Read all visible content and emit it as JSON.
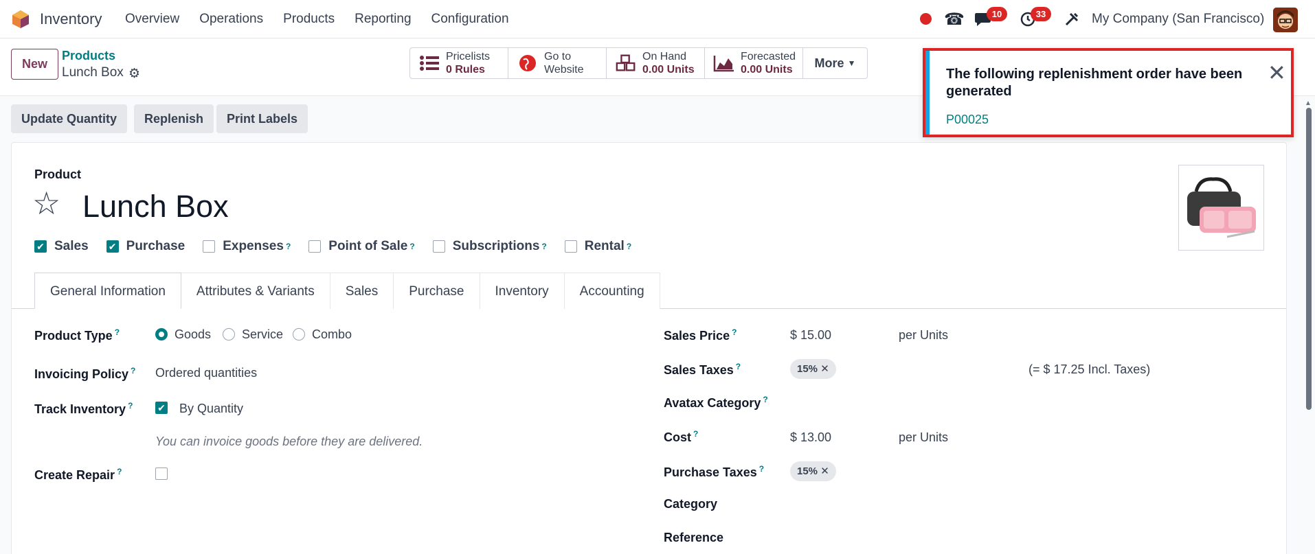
{
  "navbar": {
    "app_name": "Inventory",
    "menu": [
      "Overview",
      "Operations",
      "Products",
      "Reporting",
      "Configuration"
    ],
    "chat_badge": "10",
    "activity_badge": "33",
    "company": "My Company (San Francisco)"
  },
  "control_panel": {
    "new_label": "New",
    "breadcrumb_parent": "Products",
    "breadcrumb_current": "Lunch Box",
    "smart_buttons": [
      {
        "icon": "list-icon",
        "label": "Pricelists",
        "value": "0 Rules"
      },
      {
        "icon": "globe-icon",
        "label": "Go to",
        "value": "Website"
      },
      {
        "icon": "cubes-icon",
        "label": "On Hand",
        "value": "0.00 Units"
      },
      {
        "icon": "area-chart-icon",
        "label": "Forecasted",
        "value": "0.00 Units"
      }
    ],
    "more_label": "More"
  },
  "actions": [
    "Update Quantity",
    "Replenish",
    "Print Labels"
  ],
  "form": {
    "product_label": "Product",
    "title": "Lunch Box",
    "flags": [
      {
        "label": "Sales",
        "checked": true,
        "help": false
      },
      {
        "label": "Purchase",
        "checked": true,
        "help": false
      },
      {
        "label": "Expenses",
        "checked": false,
        "help": true
      },
      {
        "label": "Point of Sale",
        "checked": false,
        "help": true
      },
      {
        "label": "Subscriptions",
        "checked": false,
        "help": true
      },
      {
        "label": "Rental",
        "checked": false,
        "help": true
      }
    ],
    "tabs": [
      "General Information",
      "Attributes & Variants",
      "Sales",
      "Purchase",
      "Inventory",
      "Accounting"
    ],
    "left": {
      "product_type_label": "Product Type",
      "product_type_options": [
        "Goods",
        "Service",
        "Combo"
      ],
      "invoicing_label": "Invoicing Policy",
      "invoicing_value": "Ordered quantities",
      "track_label": "Track Inventory",
      "track_value": "By Quantity",
      "hint": "You can invoice goods before they are delivered.",
      "repair_label": "Create Repair"
    },
    "right": {
      "sales_price_label": "Sales Price",
      "sales_price_value": "$ 15.00",
      "sales_price_unit": "per Units",
      "sales_taxes_label": "Sales Taxes",
      "sales_taxes_tag": "15%",
      "incl_taxes": "(= $ 17.25 Incl. Taxes)",
      "avatax_label": "Avatax Category",
      "cost_label": "Cost",
      "cost_value": "$ 13.00",
      "cost_unit": "per Units",
      "purchase_taxes_label": "Purchase Taxes",
      "purchase_taxes_tag": "15%",
      "category_label": "Category",
      "reference_label": "Reference"
    },
    "help_mark": "?"
  },
  "notification": {
    "title": "The following replenishment order have been generated",
    "link": "P00025"
  }
}
